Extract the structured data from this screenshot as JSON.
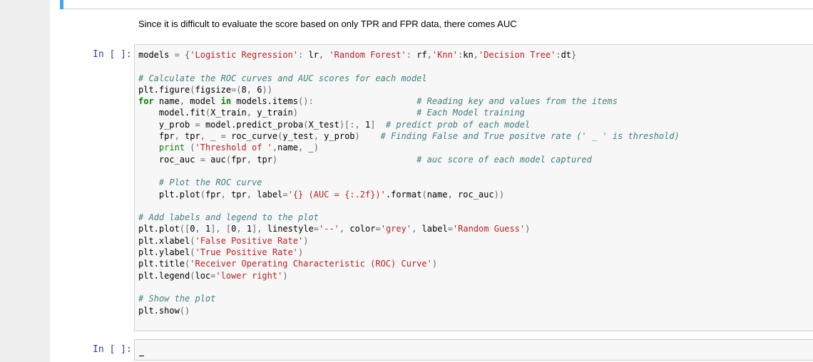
{
  "markdown": {
    "text": "Since it is difficult to evaluate the score based on only TPR and FPR data, there comes AUC"
  },
  "prompts": {
    "code_cell": "In [ ]:",
    "empty_cell": "In [ ]:"
  },
  "code_lines": [
    "models = {'Logistic Regression': lr, 'Random Forest': rf,'Knn':kn,'Decision Tree':dt}",
    "",
    "# Calculate the ROC curves and AUC scores for each model",
    "plt.figure(figsize=(8, 6))",
    "for name, model in models.items():                    # Reading key and values from the items",
    "    model.fit(X_train, y_train)                       # Each Model training",
    "    y_prob = model.predict_proba(X_test)[:, 1]  # predict prob of each model",
    "    fpr, tpr, _ = roc_curve(y_test, y_prob)    # Finding False and True positve rate (' _ ' is threshold)",
    "    print ('Threshold of ',name, _)",
    "    roc_auc = auc(fpr, tpr)                           # auc score of each model captured",
    "",
    "    # Plot the ROC curve",
    "    plt.plot(fpr, tpr, label='{} (AUC = {:.2f})'.format(name, roc_auc))",
    "",
    "# Add labels and legend to the plot",
    "plt.plot([0, 1], [0, 1], linestyle='--', color='grey', label='Random Guess')",
    "plt.xlabel('False Positive Rate')",
    "plt.ylabel('True Positive Rate')",
    "plt.title('Receiver Operating Characteristic (ROC) Curve')",
    "plt.legend(loc='lower right')",
    "",
    "# Show the plot",
    "plt.show()"
  ],
  "colors": {
    "prompt": "#303f9f",
    "comment": "#408080",
    "keyword": "#008000",
    "string": "#ba2121",
    "cell_background": "#f7f7f7",
    "selected_bar": "#42a5f5"
  }
}
